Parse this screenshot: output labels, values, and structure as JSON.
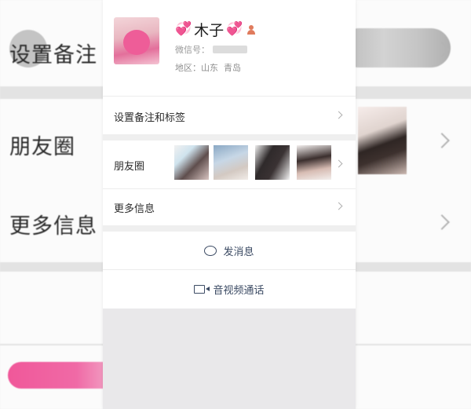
{
  "background": {
    "row1_label": "设置备注",
    "row2_label": "朋友圈",
    "row3_label": "更多信息"
  },
  "profile": {
    "name": "木子",
    "heart_left": "💞",
    "heart_right": "💞",
    "wechat_id_label": "微信号：",
    "region": "地区：山东  青岛"
  },
  "menu": {
    "remark_tags": "设置备注和标签",
    "moments": "朋友圈",
    "more_info": "更多信息"
  },
  "actions": {
    "send_message": "发消息",
    "av_call": "音视频通话"
  }
}
